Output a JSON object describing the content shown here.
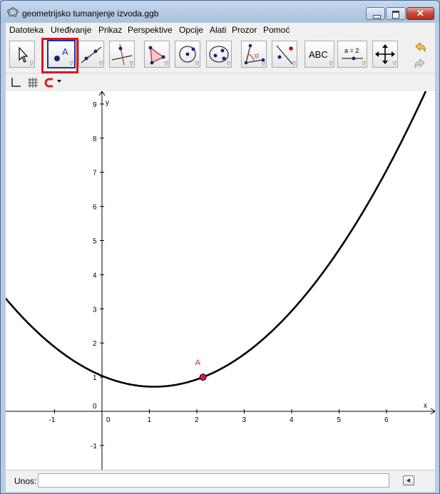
{
  "window": {
    "title": "geometrijsko tumanjenje izvoda.ggb",
    "close_glyph": "✕"
  },
  "menu": [
    "Datoteka",
    "Uređivanje",
    "Prikaz",
    "Perspektive",
    "Opcije",
    "Alati",
    "Prozor",
    "Pomoć"
  ],
  "toolbar": {
    "text_tool_label": "ABC",
    "slider_tool_label": "a = 2",
    "point_tool_label": "A",
    "angle_tool_label": "α",
    "selected_tool": "new-point"
  },
  "graphics": {
    "x_axis_label": "x",
    "y_axis_label": "y",
    "x_ticks": [
      "-1",
      "0",
      "1",
      "2",
      "3",
      "4",
      "5",
      "6"
    ],
    "y_ticks": [
      "-1",
      "0",
      "1",
      "2",
      "3",
      "4",
      "5",
      "6",
      "7",
      "8",
      "9"
    ],
    "point": {
      "label": "A",
      "x": 2.13,
      "y": 1.0,
      "color": "#e0163f"
    },
    "curve": {
      "color": "#000000",
      "function_note": "parabola",
      "vertex": [
        1.1,
        0.72
      ]
    }
  },
  "input_bar": {
    "label": "Unos:",
    "value": ""
  },
  "colors": {
    "highlight": "#e0161f",
    "selected_tool_border": "#1636a3",
    "point": "#e0163f"
  }
}
